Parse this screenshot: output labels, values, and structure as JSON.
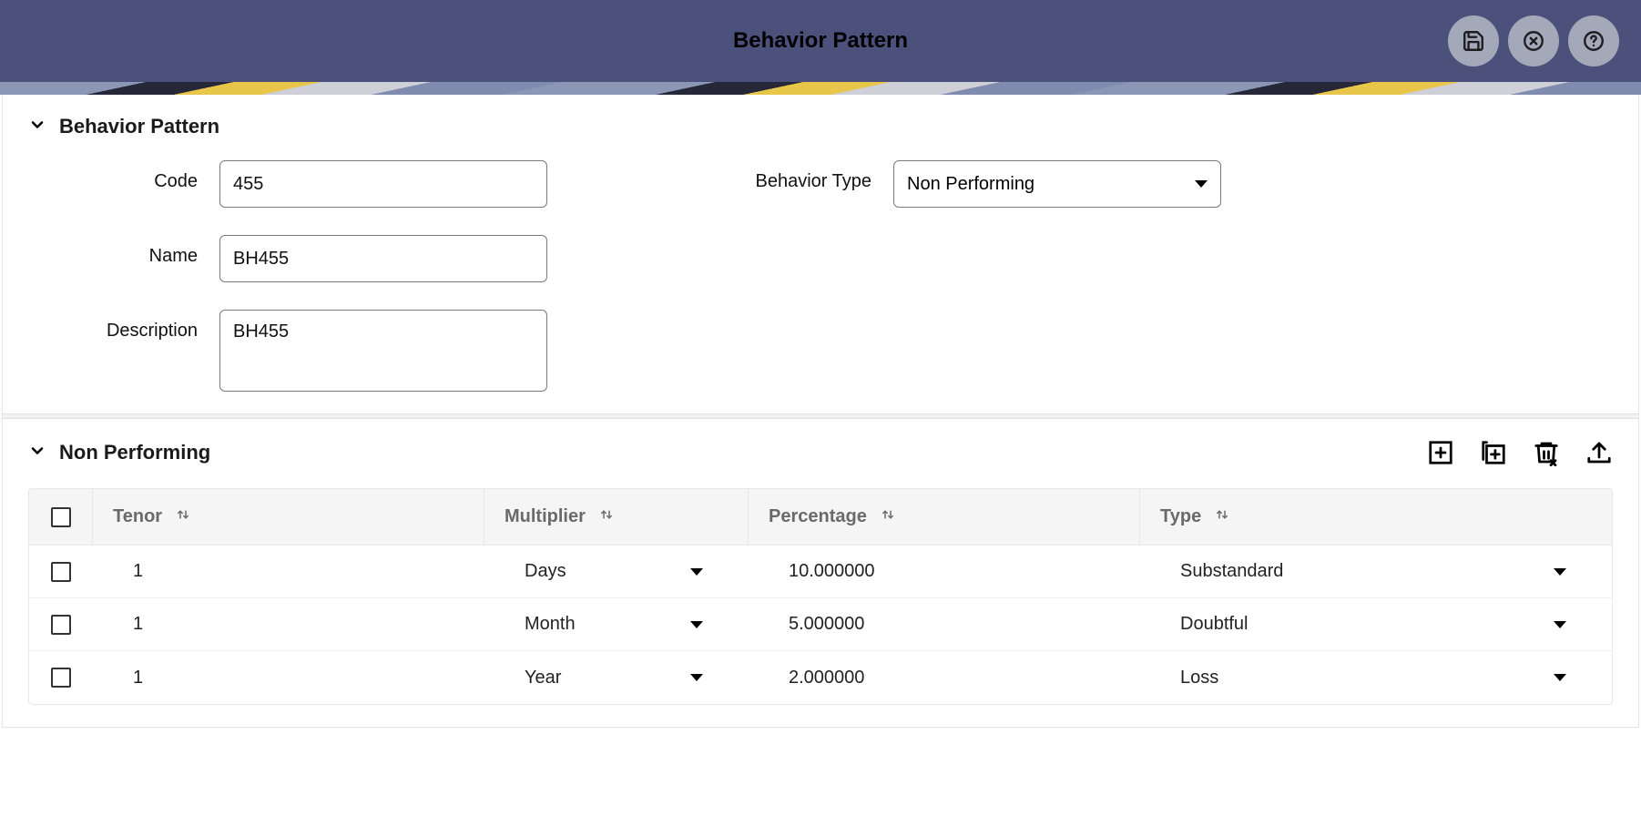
{
  "header": {
    "title": "Behavior Pattern"
  },
  "section1": {
    "title": "Behavior Pattern",
    "labels": {
      "code": "Code",
      "name": "Name",
      "description": "Description",
      "behavior_type": "Behavior Type"
    },
    "values": {
      "code": "455",
      "name": "BH455",
      "description": "BH455",
      "behavior_type": "Non Performing"
    }
  },
  "section2": {
    "title": "Non Performing",
    "columns": {
      "tenor": "Tenor",
      "multiplier": "Multiplier",
      "percentage": "Percentage",
      "type": "Type"
    },
    "rows": [
      {
        "tenor": "1",
        "multiplier": "Days",
        "percentage": "10.000000",
        "type": "Substandard"
      },
      {
        "tenor": "1",
        "multiplier": "Month",
        "percentage": "5.000000",
        "type": "Doubtful"
      },
      {
        "tenor": "1",
        "multiplier": "Year",
        "percentage": "2.000000",
        "type": "Loss"
      }
    ]
  }
}
